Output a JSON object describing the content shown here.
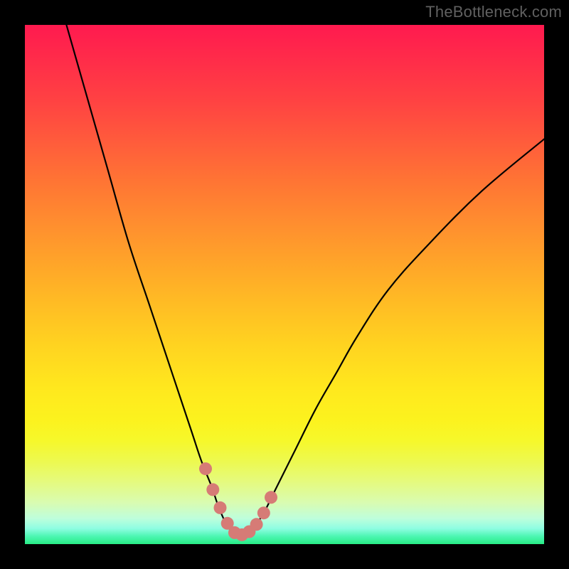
{
  "watermark": "TheBottleneck.com",
  "colors": {
    "frame": "#000000",
    "curve": "#000000",
    "marker": "#d67b76",
    "gradient_top": "#ff1a4f",
    "gradient_mid": "#ffe81e",
    "gradient_bottom": "#28ec85"
  },
  "chart_data": {
    "type": "line",
    "title": "",
    "xlabel": "",
    "ylabel": "",
    "xlim": [
      0,
      100
    ],
    "ylim": [
      0,
      100
    ],
    "grid": false,
    "legend": false,
    "series": [
      {
        "name": "bottleneck-curve",
        "x": [
          8,
          12,
          16,
          20,
          24,
          28,
          32,
          34,
          36,
          37,
          38,
          39,
          40,
          41,
          42,
          43,
          44,
          46,
          48,
          52,
          56,
          60,
          64,
          70,
          78,
          88,
          100
        ],
        "y": [
          100,
          86,
          72,
          58,
          46,
          34,
          22,
          16,
          11,
          8,
          5.5,
          3.5,
          2.2,
          1.6,
          1.6,
          2.0,
          3.0,
          6.0,
          10,
          18,
          26,
          33,
          40,
          49,
          58,
          68,
          78
        ]
      }
    ],
    "markers": {
      "name": "highlight-points",
      "x": [
        34.8,
        36.2,
        37.6,
        39.0,
        40.4,
        41.8,
        43.2,
        44.6,
        46.0,
        47.4
      ],
      "y": [
        14.5,
        10.5,
        7.0,
        4.0,
        2.2,
        1.8,
        2.4,
        3.8,
        6.0,
        9.0
      ]
    }
  }
}
